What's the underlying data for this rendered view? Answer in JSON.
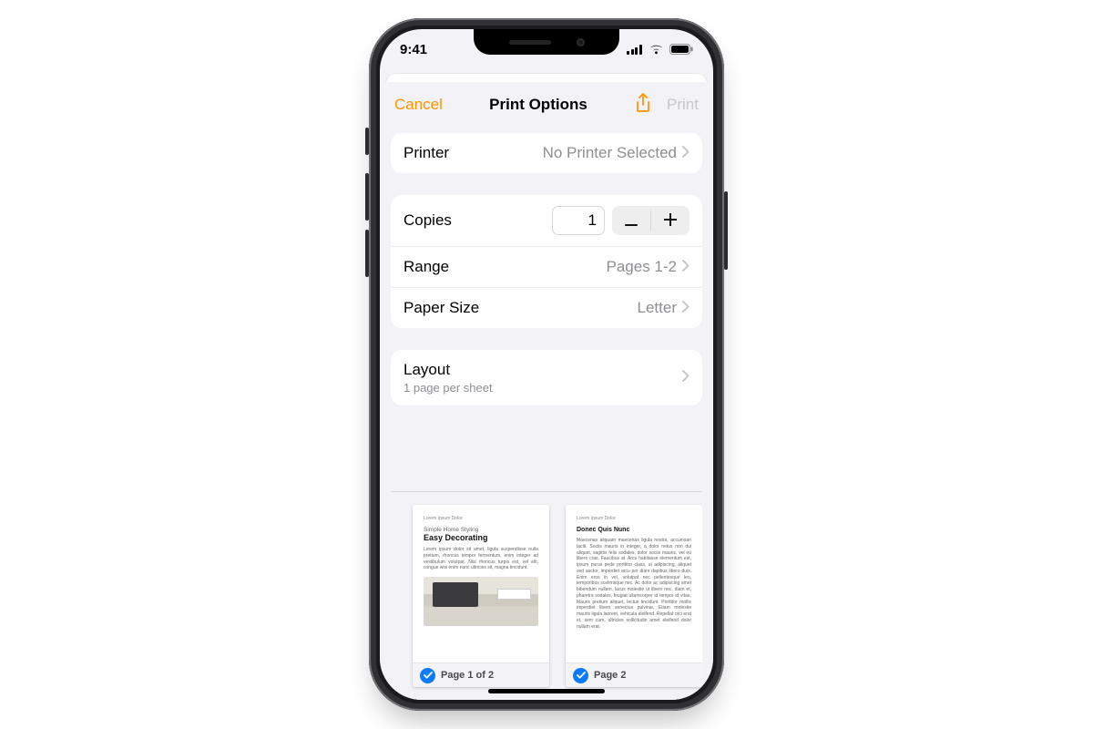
{
  "status": {
    "time": "9:41"
  },
  "nav": {
    "cancel": "Cancel",
    "title": "Print Options",
    "print": "Print"
  },
  "printer": {
    "label": "Printer",
    "value": "No Printer Selected"
  },
  "copies": {
    "label": "Copies",
    "value": "1"
  },
  "range": {
    "label": "Range",
    "value": "Pages 1-2"
  },
  "paper": {
    "label": "Paper Size",
    "value": "Letter"
  },
  "layout": {
    "label": "Layout",
    "detail": "1 page per sheet"
  },
  "preview": {
    "page1": {
      "header": "Lorem Ipsum Dolor",
      "subtitle": "Simple Home Styling",
      "title": "Easy Decorating",
      "caption": "Page 1 of 2"
    },
    "page2": {
      "header": "Lorem Ipsum Dolor",
      "title": "Donec Quis Nunc",
      "caption": "Page 2"
    }
  },
  "colors": {
    "accent": "#ff9500",
    "selection": "#0a7aff"
  }
}
